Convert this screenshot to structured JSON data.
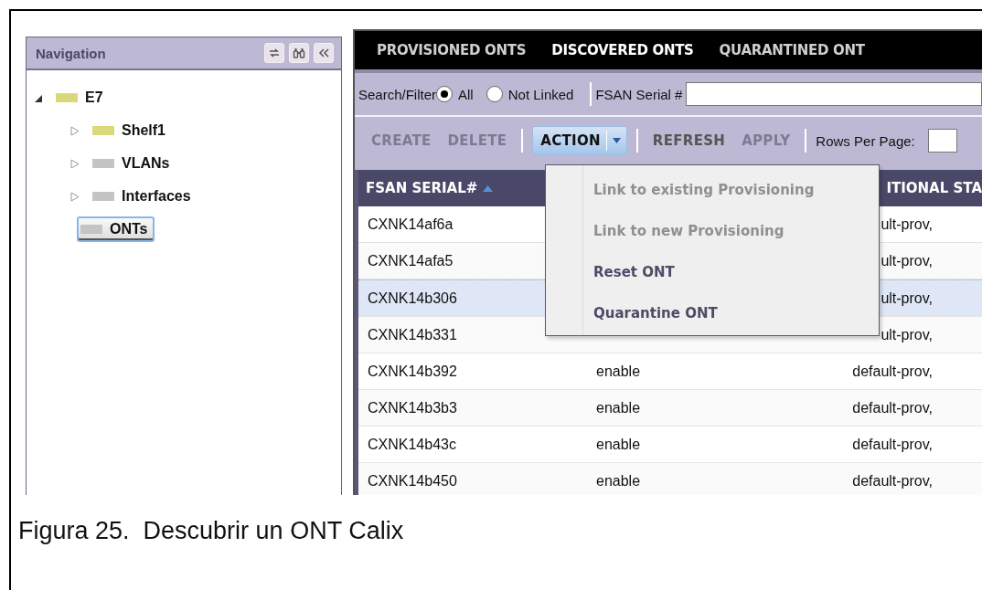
{
  "navigation": {
    "title": "Navigation",
    "tree": [
      {
        "label": "E7",
        "color": "#d9d97a",
        "expanded": true,
        "leaf": false,
        "selected": false,
        "children": [
          {
            "label": "Shelf1",
            "color": "#d9d97a",
            "expanded": false,
            "leaf": false,
            "selected": false
          },
          {
            "label": "VLANs",
            "color": "#c4c4c4",
            "expanded": false,
            "leaf": false,
            "selected": false
          },
          {
            "label": "Interfaces",
            "color": "#c4c4c4",
            "expanded": false,
            "leaf": false,
            "selected": false
          },
          {
            "label": "ONTs",
            "color": "#c4c4c4",
            "expanded": false,
            "leaf": true,
            "selected": true
          }
        ]
      }
    ]
  },
  "tabs": [
    {
      "label": "PROVISIONED ONTS",
      "selected": false
    },
    {
      "label": "DISCOVERED ONTS",
      "selected": true
    },
    {
      "label": "QUARANTINED ONT",
      "selected": false
    }
  ],
  "search": {
    "label": "Search/Filter",
    "options": [
      {
        "label": "All",
        "selected": true
      },
      {
        "label": "Not Linked",
        "selected": false
      }
    ],
    "field_label": "FSAN Serial #"
  },
  "toolbar": {
    "buttons": [
      {
        "label": "CREATE",
        "disabled": true,
        "kind": "plain"
      },
      {
        "label": "DELETE",
        "disabled": true,
        "kind": "plain"
      },
      {
        "label": "ACTION",
        "disabled": false,
        "kind": "dropdown"
      },
      {
        "label": "REFRESH",
        "disabled": false,
        "kind": "plain"
      },
      {
        "label": "APPLY",
        "disabled": true,
        "kind": "plain"
      }
    ],
    "rows_label": "Rows Per Page:"
  },
  "table": {
    "columns": [
      {
        "label": "FSAN SERIAL#",
        "sorted": true
      },
      {
        "label": "ITIONAL STA",
        "sorted": false
      }
    ],
    "rows": [
      {
        "serial": "CXNK14af6a",
        "column_3": "ult-prov,",
        "selected": false
      },
      {
        "serial": "CXNK14afa5",
        "column_3": "ult-prov,",
        "selected": false
      },
      {
        "serial": "CXNK14b306",
        "column_3": "ult-prov,",
        "selected": true
      },
      {
        "serial": "CXNK14b331",
        "column_3": "ult-prov,",
        "selected": false
      },
      {
        "serial": "CXNK14b392",
        "column_2": "enable",
        "column_3": "default-prov,",
        "selected": false
      },
      {
        "serial": "CXNK14b3b3",
        "column_2": "enable",
        "column_3": "default-prov,",
        "selected": false
      },
      {
        "serial": "CXNK14b43c",
        "column_2": "enable",
        "column_3": "default-prov,",
        "selected": false
      },
      {
        "serial": "CXNK14b450",
        "column_2": "enable",
        "column_3": "default-prov,",
        "selected": false
      }
    ]
  },
  "action_menu": [
    {
      "label": "Link to existing Provisioning",
      "disabled": true
    },
    {
      "label": "Link to new Provisioning",
      "disabled": true
    },
    {
      "label": "Reset ONT",
      "disabled": false
    },
    {
      "label": "Quarantine ONT",
      "disabled": false
    }
  ],
  "caption": "Figura 25.  Descubrir un ONT Calix"
}
